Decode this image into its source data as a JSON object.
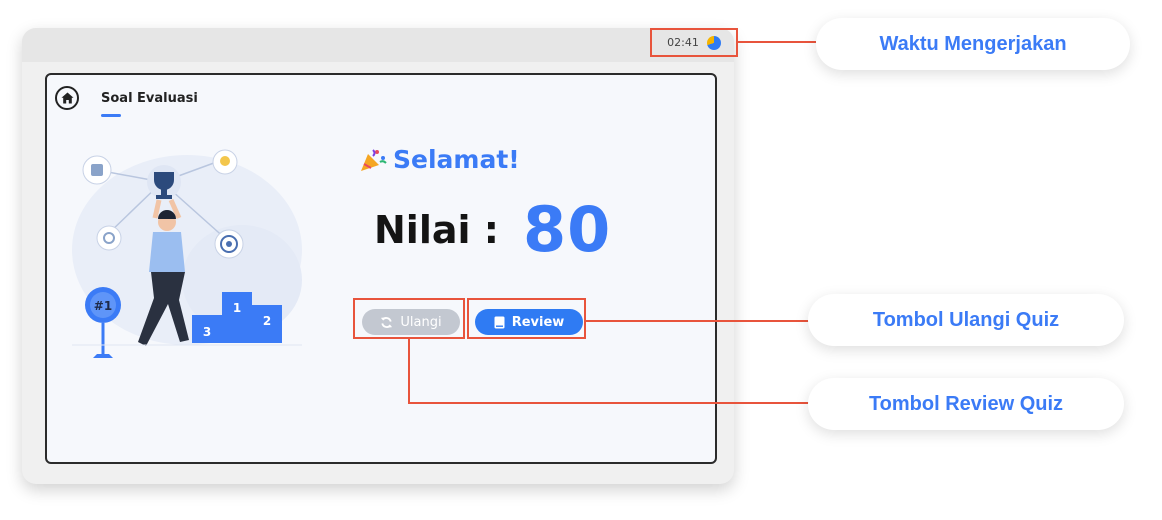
{
  "timer": {
    "value": "02:41",
    "icon": "timer-icon"
  },
  "header": {
    "title": "Soal Evaluasi",
    "home_icon": "home-icon"
  },
  "result": {
    "heading": "Selamat!",
    "heading_icon": "party-popper-icon",
    "score_label": "Nilai :",
    "score_value": "80"
  },
  "buttons": {
    "ulangi_label": "Ulangi",
    "ulangi_icon": "refresh-icon",
    "review_label": "Review",
    "review_icon": "book-icon"
  },
  "illustration": {
    "badge_text": "#1",
    "podium": [
      "1",
      "2",
      "3"
    ]
  },
  "callouts": {
    "waktu": "Waktu Mengerjakan",
    "ulangi": "Tombol Ulangi Quiz",
    "review": "Tombol Review Quiz"
  },
  "colors": {
    "accent": "#3b7bf6",
    "annotation": "#e8543c",
    "disabled": "#c3c8d1"
  }
}
